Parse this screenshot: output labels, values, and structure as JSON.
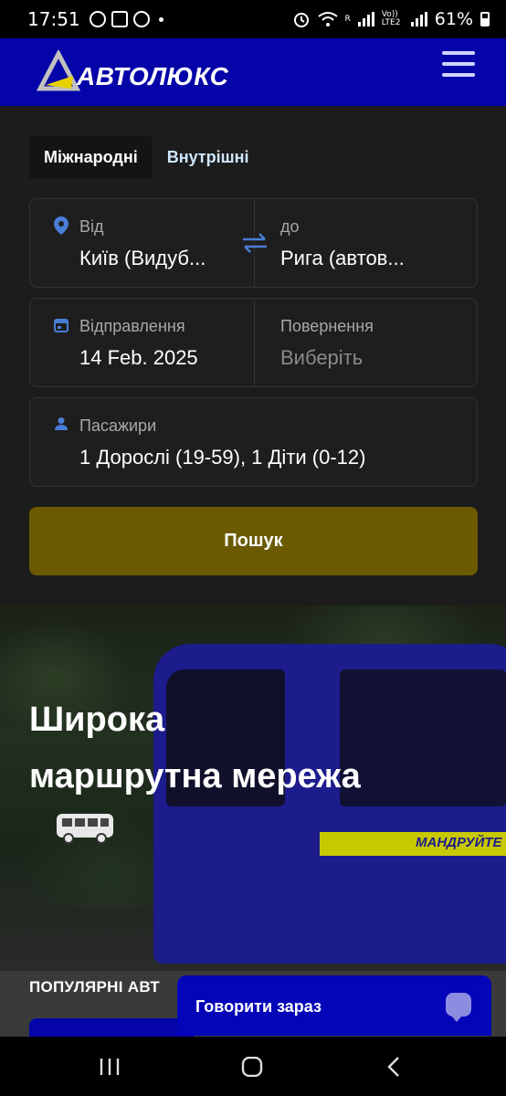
{
  "status_bar": {
    "time": "17:51",
    "battery": "61%",
    "net_top": "R",
    "volte": "Vo)) LTE2"
  },
  "header": {
    "logo_text": "АВТОЛЮКС"
  },
  "tabs": [
    {
      "label": "Міжнародні"
    },
    {
      "label": "Внутрішні"
    }
  ],
  "route": {
    "from_label": "Від",
    "from_value": "Київ (Видуб...",
    "to_label": "до",
    "to_value": "Рига (автов..."
  },
  "dates": {
    "departure_label": "Відправлення",
    "departure_value": "14 Feb. 2025",
    "return_label": "Повернення",
    "return_value": "Виберіть"
  },
  "passengers": {
    "label": "Пасажири",
    "value": "1 Дорослі (19-59), 1 Діти (0-12)"
  },
  "search_button": "Пошук",
  "hero": {
    "title_line1": "Широка",
    "title_line2": "маршрутна мережа",
    "bus_stripe_text": "МАНДРУЙТЕ",
    "popular_heading": "ПОПУЛЯРНІ АВТ"
  },
  "chat": {
    "label": "Говорити зараз"
  },
  "colors": {
    "brand_blue": "#0404a8",
    "search_button": "#6b5a00",
    "panel": "#1c1c1c",
    "accent_icon": "#4a7dd8"
  }
}
